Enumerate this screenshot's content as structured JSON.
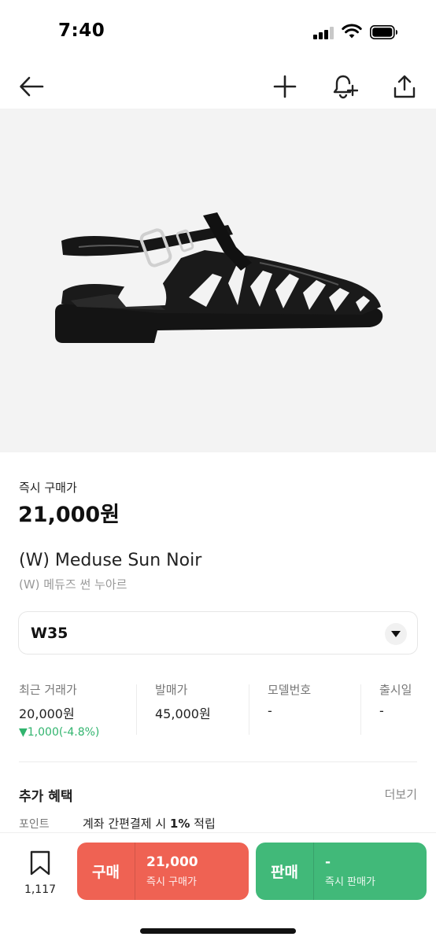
{
  "status_bar": {
    "time": "7:40"
  },
  "nav": {
    "icons": [
      "back-arrow-icon",
      "plus-icon",
      "bell-plus-icon",
      "share-icon"
    ]
  },
  "product": {
    "image_desc": "black-jelly-sandal",
    "price_label": "즉시 구매가",
    "price_value": "21,000원",
    "title": "(W) Meduse Sun Noir",
    "subtitle": "(W) 메듀즈 썬 누아르"
  },
  "size_select": {
    "value": "W35"
  },
  "info": {
    "recent": {
      "label": "최근 거래가",
      "value": "20,000원",
      "change": "▼1,000(-4.8%)"
    },
    "release_price": {
      "label": "발매가",
      "value": "45,000원"
    },
    "model": {
      "label": "모델번호",
      "value": "-"
    },
    "release_date": {
      "label": "출시일",
      "value": "-"
    }
  },
  "benefits": {
    "title": "추가 혜택",
    "more": "더보기",
    "key": "포인트",
    "value_prefix": "계좌 간편결제 시 ",
    "value_bold": "1%",
    "value_suffix": " 적립"
  },
  "bottom_bar": {
    "bookmark_count": "1,117",
    "buy": {
      "label": "구매",
      "price": "21,000",
      "sub": "즉시 구매가"
    },
    "sell": {
      "label": "판매",
      "price": "-",
      "sub": "즉시 판매가"
    }
  },
  "colors": {
    "buy": "#ef6253",
    "sell": "#41b979",
    "price_down": "#31b46e"
  }
}
